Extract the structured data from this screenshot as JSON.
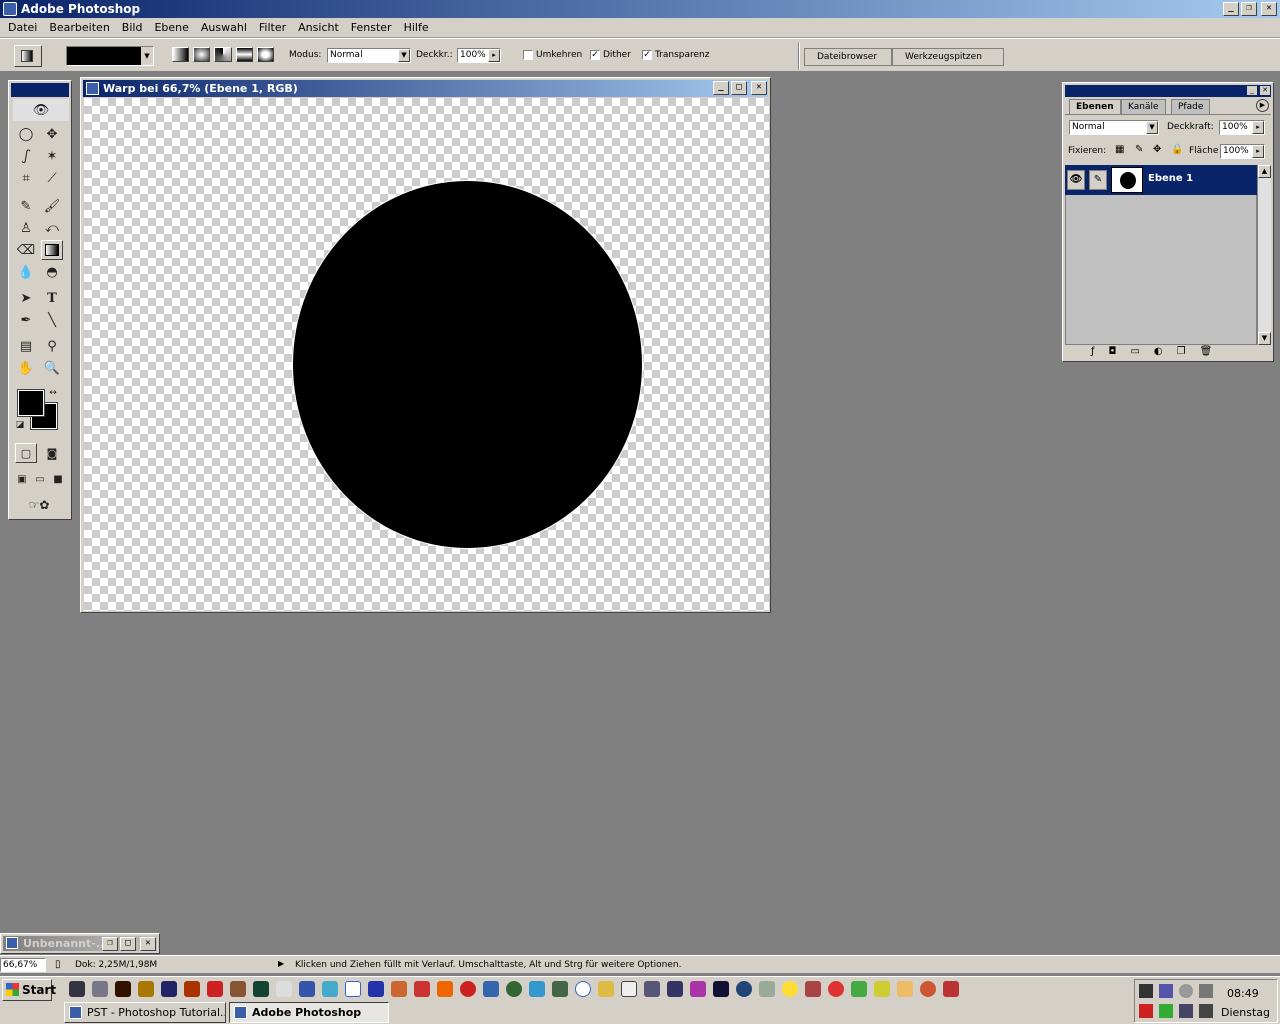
{
  "app": {
    "title": "Adobe Photoshop"
  },
  "menu": [
    "Datei",
    "Bearbeiten",
    "Bild",
    "Ebene",
    "Auswahl",
    "Filter",
    "Ansicht",
    "Fenster",
    "Hilfe"
  ],
  "options": {
    "modus_label": "Modus:",
    "modus_value": "Normal",
    "deckkraft_label": "Deckkr.:",
    "deckkraft_value": "100%",
    "umkehren_label": "Umkehren",
    "umkehren_checked": false,
    "dither_label": "Dither",
    "dither_checked": true,
    "transparenz_label": "Transparenz",
    "transparenz_checked": true,
    "gradient_types": [
      "linear-gradient-icon",
      "radial-gradient-icon",
      "angle-gradient-icon",
      "reflected-gradient-icon",
      "diamond-gradient-icon"
    ]
  },
  "palette_well": {
    "tabs": [
      "Dateibrowser",
      "Werkzeugspitzen"
    ]
  },
  "document": {
    "title": "Warp bei 66,7% (Ebene 1, RGB)"
  },
  "layers_panel": {
    "tabs": [
      "Ebenen",
      "Kanäle",
      "Pfade"
    ],
    "active_tab": "Ebenen",
    "blend_mode": "Normal",
    "opacity_label": "Deckkraft:",
    "opacity_value": "100%",
    "lock_label": "Fixieren:",
    "fill_label": "Fläche",
    "fill_value": "100%",
    "layers": [
      {
        "name": "Ebene 1",
        "visible": true,
        "selected": true
      }
    ]
  },
  "minimized_window": {
    "title": "Unbenannt-..."
  },
  "status": {
    "zoom": "66,67%",
    "doc_size": "Dok: 2,25M/1,98M",
    "hint": "Klicken und Ziehen füllt mit Verlauf. Umschalttaste, Alt und Strg für weitere Optionen."
  },
  "taskbar": {
    "start_label": "Start",
    "buttons": [
      {
        "label": "PST - Photoshop Tutorial...",
        "active": false
      },
      {
        "label": "Adobe Photoshop",
        "active": true
      }
    ],
    "clock": "08:49",
    "day": "Dienstag"
  },
  "colors": {
    "title_from": "#0a246a",
    "title_to": "#a6caf0",
    "face": "#d4d0c8",
    "desktop": "#808080",
    "foreground": "#000000",
    "background": "#000000"
  }
}
